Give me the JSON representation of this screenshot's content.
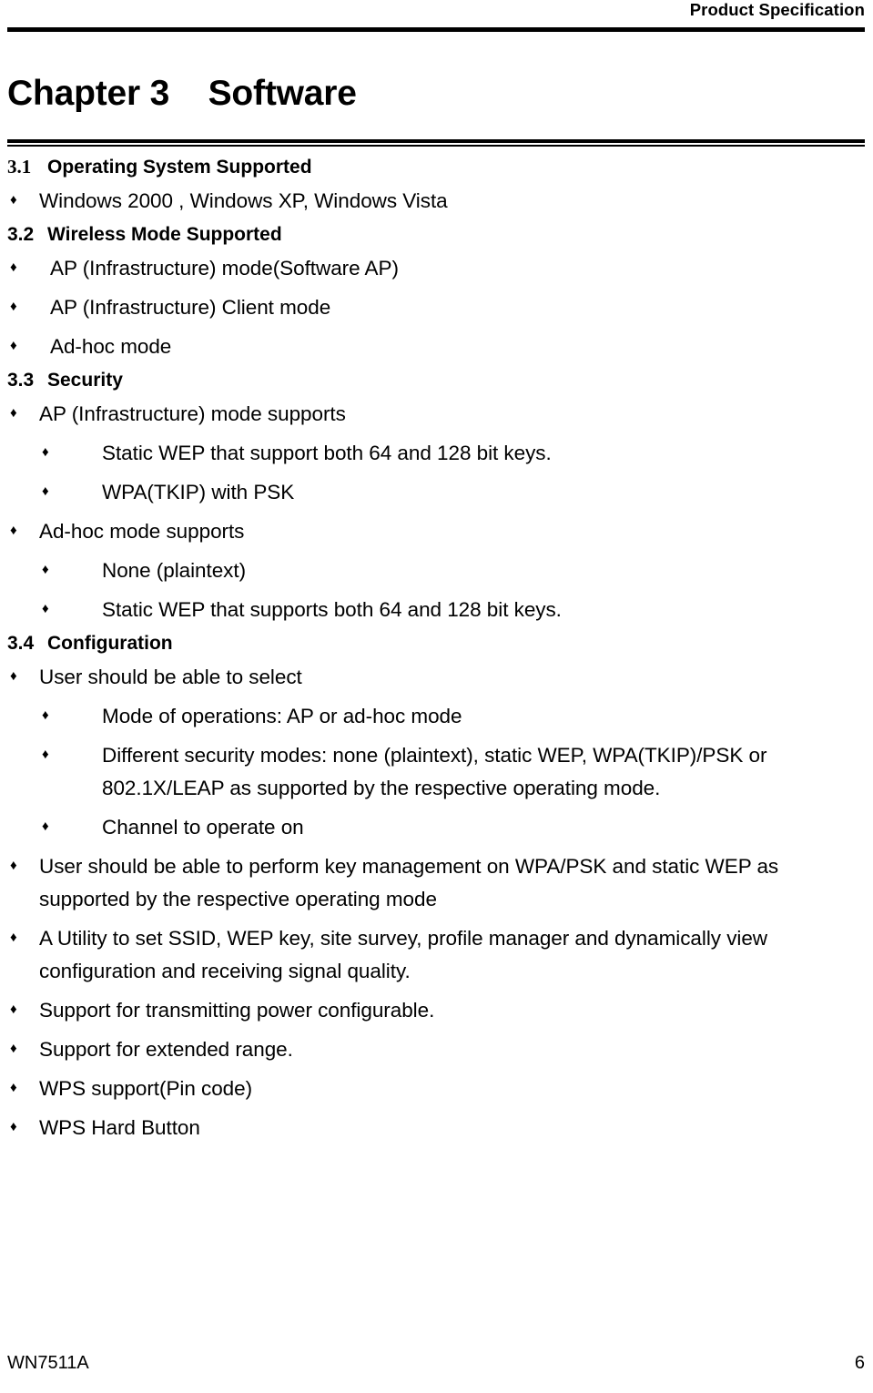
{
  "header": {
    "running_title": "Product Specification"
  },
  "chapter": {
    "label": "Chapter 3",
    "title": "Software",
    "full": "Chapter 3    Software"
  },
  "bullet_glyph": "♦",
  "sections": [
    {
      "number": "3.1",
      "title": "Operating System Supported",
      "items": [
        {
          "level": 1,
          "text": "Windows 2000 , Windows XP, Windows Vista"
        }
      ]
    },
    {
      "number": "3.2",
      "title": "Wireless Mode Supported",
      "items": [
        {
          "level": 1,
          "text": "AP (Infrastructure) mode(Software AP)"
        },
        {
          "level": 1,
          "text": "AP (Infrastructure) Client mode"
        },
        {
          "level": 1,
          "text": "Ad-hoc mode"
        }
      ]
    },
    {
      "number": "3.3",
      "title": "Security",
      "items": [
        {
          "level": 1,
          "text": "AP (Infrastructure) mode supports"
        },
        {
          "level": 2,
          "text": "Static WEP that support both 64 and 128 bit keys."
        },
        {
          "level": 2,
          "text": "WPA(TKIP) with PSK"
        },
        {
          "level": 1,
          "text": "Ad-hoc mode supports"
        },
        {
          "level": 2,
          "text": "None (plaintext)"
        },
        {
          "level": 2,
          "text": "Static WEP that supports both 64 and 128 bit keys."
        }
      ]
    },
    {
      "number": "3.4",
      "title": "Configuration",
      "items": [
        {
          "level": 1,
          "text": "User should be able to select"
        },
        {
          "level": 2,
          "text": "Mode of operations: AP or ad-hoc mode"
        },
        {
          "level": 2,
          "text": "Different security modes: none (plaintext), static WEP, WPA(TKIP)/PSK or 802.1X/LEAP as supported by the respective operating mode."
        },
        {
          "level": 2,
          "text": "Channel to operate on"
        },
        {
          "level": 1,
          "text": "User should be able to perform key management on WPA/PSK and static WEP as supported by the respective operating mode"
        },
        {
          "level": 1,
          "text": "A Utility to set SSID, WEP key, site survey, profile manager and dynamically view configuration and receiving signal quality."
        },
        {
          "level": 1,
          "text": "Support for transmitting power configurable."
        },
        {
          "level": 1,
          "text": "Support for extended range."
        },
        {
          "level": 1,
          "text": "WPS support(Pin code)"
        },
        {
          "level": 1,
          "text": "WPS Hard Button"
        }
      ]
    }
  ],
  "footer": {
    "model": "WN7511A",
    "page_number": "6"
  }
}
